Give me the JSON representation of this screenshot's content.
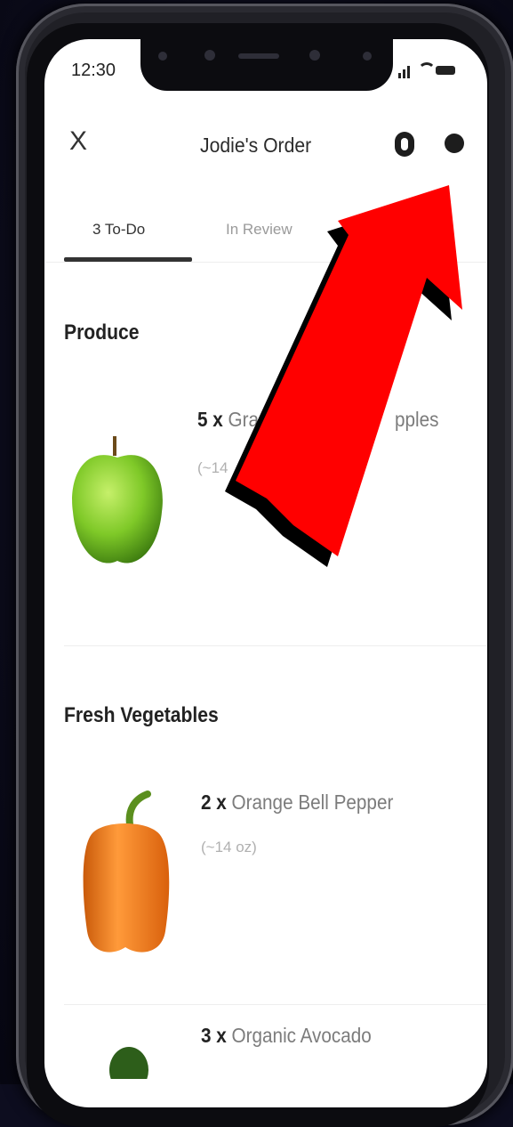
{
  "status_bar": {
    "time": "12:30"
  },
  "header": {
    "title": "Jodie's Order",
    "close": "X"
  },
  "tabs": [
    {
      "label": "3 To-Do"
    },
    {
      "label": "In Review"
    }
  ],
  "sections": [
    {
      "title": "Produce",
      "items": [
        {
          "qty": "5 x",
          "name_visible_start": "Gra",
          "name_visible_end": "pples",
          "size": "(~14"
        }
      ]
    },
    {
      "title": "Fresh Vegetables",
      "items": [
        {
          "qty": "2 x",
          "name": "Orange Bell Pepper",
          "size": "(~14 oz)"
        },
        {
          "qty": "3 x",
          "name": "Organic Avocado"
        }
      ]
    }
  ],
  "icons": {
    "close": "close-icon",
    "help": "help-icon",
    "more": "more-options-icon",
    "apple": "green-apple-image",
    "pepper": "orange-bell-pepper-image",
    "avocado": "avocado-image",
    "annotation": "red-arrow-annotation"
  },
  "colors": {
    "annotation_arrow": "#ff0000",
    "background": "#0d0d1f",
    "screen": "#ffffff",
    "apple": "#7fc928",
    "pepper": "#f07a1a",
    "avocado": "#2d5e1a"
  }
}
